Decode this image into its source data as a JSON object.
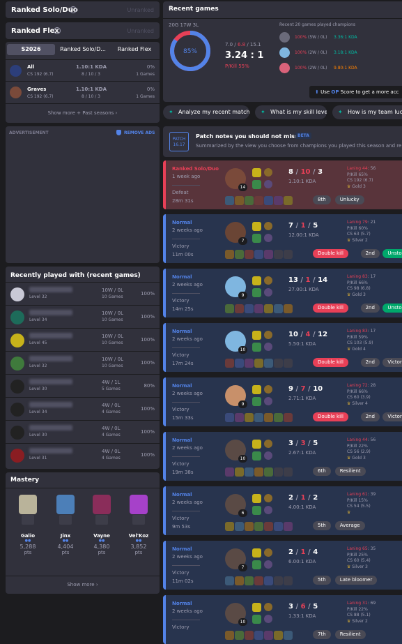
{
  "ranked_solo": {
    "title": "Ranked Solo/Duo",
    "status": "Unranked"
  },
  "ranked_flex": {
    "title": "Ranked Flex",
    "status": "Unranked"
  },
  "season_tabs": [
    "S2026",
    "Ranked Solo/D...",
    "Ranked Flex"
  ],
  "season_stats": [
    {
      "champion": "All",
      "cs": "CS 192 (6.7)",
      "kda": "1.10:1 KDA",
      "kda_detail": "8 / 10 / 3",
      "winrate": "0%",
      "games": "1 Games"
    },
    {
      "champion": "Graves",
      "cs": "CS 192 (6.7)",
      "kda": "1.10:1 KDA",
      "kda_detail": "8 / 10 / 3",
      "winrate": "0%",
      "games": "1 Games"
    }
  ],
  "show_more_seasons": "Show more + Past seasons",
  "advertisement": {
    "label": "ADVERTISEMENT",
    "remove": "REMOVE ADS"
  },
  "recently_played": {
    "title": "Recently played with (recent games)",
    "players": [
      {
        "level": "Level 32",
        "record": "10W / 0L",
        "games": "10 Games",
        "winrate": "100%",
        "color": "#c9c9d6"
      },
      {
        "level": "Level 34",
        "record": "10W / 0L",
        "games": "10 Games",
        "winrate": "100%",
        "color": "#1d6b5a"
      },
      {
        "name": "NO LEGS...9",
        "level": "Level 45",
        "record": "10W / 0L",
        "games": "10 Games",
        "winrate": "100%",
        "color": "#c7b21a"
      },
      {
        "name": "...9",
        "level": "Level 32",
        "record": "10W / 0L",
        "games": "10 Games",
        "winrate": "100%",
        "color": "#3f7a3c"
      },
      {
        "name": "1...",
        "level": "Level 30",
        "record": "4W / 1L",
        "games": "5 Games",
        "winrate": "80%",
        "color": "#222"
      },
      {
        "name": "...4",
        "level": "Level 34",
        "record": "4W / 0L",
        "games": "4 Games",
        "winrate": "100%",
        "color": "#222"
      },
      {
        "name": "...King...0004",
        "level": "Level 30",
        "record": "4W / 0L",
        "games": "4 Games",
        "winrate": "100%",
        "color": "#222"
      },
      {
        "name": "...Ho...",
        "level": "Level 31",
        "record": "4W / 0L",
        "games": "4 Games",
        "winrate": "100%",
        "color": "#8a1d22"
      }
    ]
  },
  "mastery": {
    "title": "Mastery",
    "champions": [
      {
        "name": "Galio",
        "points": "5,288",
        "unit": "pts",
        "color": "#b9b39a"
      },
      {
        "name": "Jinx",
        "points": "4,404",
        "unit": "pts",
        "color": "#4c7fb8"
      },
      {
        "name": "Vayne",
        "points": "4,380",
        "unit": "pts",
        "color": "#8a2d5a"
      },
      {
        "name": "Vel'Koz",
        "points": "3,852",
        "unit": "pts",
        "color": "#a641c9"
      }
    ],
    "show_more": "Show more"
  },
  "recent_games": {
    "title": "Recent games",
    "record": "20G 17W 3L",
    "winrate": "85%",
    "winrate_fraction": 0.85,
    "kda_line": {
      "k": "7.0",
      "d": "6.8",
      "a": "15.1"
    },
    "kda_ratio": "3.24 : 1",
    "kill_participation": "P/Kill 55%",
    "champions_title": "Recent 20 games played champions",
    "top_champions": [
      {
        "wr": "100%",
        "record": "(5W / 0L)",
        "kda": "3.36:1 KDA",
        "kda_color": "#00bba3",
        "color": "#6a6a7a"
      },
      {
        "wr": "100%",
        "record": "(2W / 0L)",
        "kda": "3.18:1 KDA",
        "kda_color": "#00bba3",
        "color": "#7fb6e0"
      },
      {
        "wr": "100%",
        "record": "(2W / 0L)",
        "kda": "9.80:1 KDA",
        "kda_color": "#ff8200",
        "color": "#d9627a"
      }
    ],
    "op_score_prefix": "Use ",
    "op_score_brand": "OP",
    "op_score_suffix": " Score to get a more acc"
  },
  "prompts": [
    "Analyze my recent matches.",
    "What is my skill level?",
    "How is my team luck la"
  ],
  "patch": {
    "label": "PATCH",
    "version": "16.17",
    "title": "Patch notes you should not miss",
    "beta": "BETA",
    "subtitle": "Summarized by the view you choose from champions you played this season and re"
  },
  "matches": [
    {
      "queue": "Ranked Solo/Duo",
      "time": "1 week ago",
      "result": "Defeat",
      "duration": "28m 31s",
      "win": false,
      "level": "14",
      "k": "8",
      "d": "10",
      "a": "3",
      "kda": "1.10:1 KDA",
      "laning": "Laning 44",
      "laning_opp": ": 56",
      "pkill": "P/Kill 65%",
      "cs": "CS 192 (6.7)",
      "rank": "Gold 3",
      "tags": [
        {
          "text": "8th",
          "bg": "#4a4a55"
        },
        {
          "text": "Unlucky",
          "bg": "#4a4a55"
        }
      ],
      "champ": "#7a4a3a"
    },
    {
      "queue": "Normal",
      "time": "2 weeks ago",
      "result": "Victory",
      "duration": "11m 00s",
      "win": true,
      "level": "7",
      "k": "7",
      "d": "1",
      "a": "5",
      "kda": "12.00:1 KDA",
      "laning": "Laning 79",
      "laning_opp": ": 21",
      "pkill": "P/Kill 60%",
      "cs": "CS 63 (5.7)",
      "rank": "Silver 2",
      "tags": [
        {
          "text": "Double kill",
          "bg": "#e84057"
        },
        {
          "text": "2nd",
          "bg": "#4a4a55"
        },
        {
          "text": "Unstoppable",
          "bg": "#00a86b"
        }
      ],
      "champ": "#6a4535"
    },
    {
      "queue": "Normal",
      "time": "2 weeks ago",
      "result": "Victory",
      "duration": "14m 25s",
      "win": true,
      "level": "9",
      "k": "13",
      "d": "1",
      "a": "14",
      "kda": "27.00:1 KDA",
      "laning": "Laning 83",
      "laning_opp": ": 17",
      "pkill": "P/Kill 66%",
      "cs": "CS 98 (6.8)",
      "rank": "Gold 3",
      "tags": [
        {
          "text": "Double kill",
          "bg": "#e84057"
        },
        {
          "text": "2nd",
          "bg": "#4a4a55"
        },
        {
          "text": "Unstoppable",
          "bg": "#00a86b"
        }
      ],
      "champ": "#7fb6e0"
    },
    {
      "queue": "Normal",
      "time": "2 weeks ago",
      "result": "Victory",
      "duration": "17m 24s",
      "win": true,
      "level": "10",
      "k": "10",
      "d": "4",
      "a": "12",
      "kda": "5.50:1 KDA",
      "laning": "Laning 83",
      "laning_opp": ": 17",
      "pkill": "P/Kill 59%",
      "cs": "CS 103 (5.9)",
      "rank": "Gold 4",
      "tags": [
        {
          "text": "Double kill",
          "bg": "#e84057"
        },
        {
          "text": "2nd",
          "bg": "#4a4a55"
        },
        {
          "text": "Victor",
          "bg": "#4a4a55"
        }
      ],
      "champ": "#7fb6e0"
    },
    {
      "queue": "Normal",
      "time": "2 weeks ago",
      "result": "Victory",
      "duration": "15m 33s",
      "win": true,
      "level": "9",
      "k": "9",
      "d": "7",
      "a": "10",
      "kda": "2.71:1 KDA",
      "laning": "Laning 72",
      "laning_opp": ": 28",
      "pkill": "P/Kill 66%",
      "cs": "CS 60 (3.9)",
      "rank": "Silver 4",
      "tags": [
        {
          "text": "Double kill",
          "bg": "#e84057"
        },
        {
          "text": "2nd",
          "bg": "#4a4a55"
        },
        {
          "text": "Victor",
          "bg": "#4a4a55"
        }
      ],
      "champ": "#c8906a"
    },
    {
      "queue": "Normal",
      "time": "2 weeks ago",
      "result": "Victory",
      "duration": "19m 38s",
      "win": true,
      "level": "10",
      "k": "3",
      "d": "3",
      "a": "5",
      "kda": "2.67:1 KDA",
      "laning": "Laning 44",
      "laning_opp": ": 56",
      "pkill": "P/Kill 22%",
      "cs": "CS 56 (2.9)",
      "rank": "Gold 3",
      "tags": [
        {
          "text": "6th",
          "bg": "#4a4a55"
        },
        {
          "text": "Resilient",
          "bg": "#4a4a55"
        }
      ],
      "champ": "#5a4a45"
    },
    {
      "queue": "Normal",
      "time": "2 weeks ago",
      "result": "Victory",
      "duration": "9m 53s",
      "win": true,
      "level": "6",
      "k": "2",
      "d": "1",
      "a": "2",
      "kda": "4.00:1 KDA",
      "laning": "Laning 61",
      "laning_opp": ": 39",
      "pkill": "P/Kill 15%",
      "cs": "CS 54 (5.5)",
      "rank": "",
      "tags": [
        {
          "text": "5th",
          "bg": "#4a4a55"
        },
        {
          "text": "Average",
          "bg": "#4a4a55"
        }
      ],
      "champ": "#5a4a45"
    },
    {
      "queue": "Normal",
      "time": "2 weeks ago",
      "result": "Victory",
      "duration": "11m 02s",
      "win": true,
      "level": "7",
      "k": "2",
      "d": "1",
      "a": "4",
      "kda": "6.00:1 KDA",
      "laning": "Laning 65",
      "laning_opp": ": 35",
      "pkill": "P/Kill 25%",
      "cs": "CS 60 (5.4)",
      "rank": "Silver 3",
      "tags": [
        {
          "text": "5th",
          "bg": "#4a4a55"
        },
        {
          "text": "Late bloomer",
          "bg": "#4a4a55"
        }
      ],
      "champ": "#5a4a45"
    },
    {
      "queue": "Normal",
      "time": "2 weeks ago",
      "result": "Victory",
      "duration": "",
      "win": true,
      "level": "10",
      "k": "3",
      "d": "6",
      "a": "5",
      "kda": "1.33:1 KDA",
      "laning": "Laning 31",
      "laning_opp": ": 69",
      "pkill": "P/Kill 22%",
      "cs": "CS 88 (5.1)",
      "rank": "Silver 2",
      "tags": [
        {
          "text": "7th",
          "bg": "#4a4a55"
        },
        {
          "text": "Resilient",
          "bg": "#4a4a55"
        }
      ],
      "champ": "#5a4a45"
    }
  ],
  "colors": {
    "win_bg": "#28344e",
    "win_bar": "#5383e8",
    "loss_bg": "#59343b",
    "loss_bar": "#e84057",
    "win_text": "#5383e8",
    "loss_text": "#e84057",
    "panel": "#31313c",
    "page": "#1c1c1f"
  }
}
